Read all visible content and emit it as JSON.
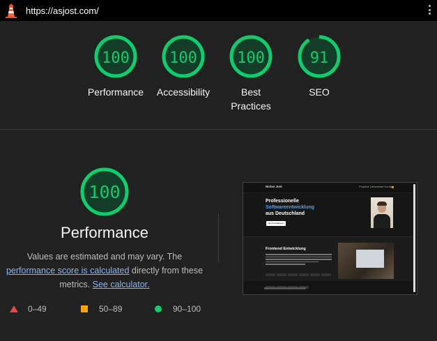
{
  "browser": {
    "url": "https://asjost.com/"
  },
  "scores": [
    {
      "key": "performance",
      "value": "100",
      "label_lines": [
        "Performance"
      ],
      "score": 100
    },
    {
      "key": "accessibility",
      "value": "100",
      "label_lines": [
        "Accessibility"
      ],
      "score": 100
    },
    {
      "key": "best_practices",
      "value": "100",
      "label_lines": [
        "Best",
        "Practices"
      ],
      "score": 100
    },
    {
      "key": "seo",
      "value": "91",
      "label_lines": [
        "SEO"
      ],
      "score": 91
    }
  ],
  "detail": {
    "score": "100",
    "title": "Performance",
    "desc_part1": "Values are estimated and may vary. The",
    "link1": "performance score is calculated",
    "desc_part2": "directly from these metrics.",
    "link2": "See calculator."
  },
  "legend": {
    "fail": "0–49",
    "average": "50–89",
    "pass": "90–100"
  },
  "thumbnail": {
    "brand": "Niclas Jost",
    "nav_links": "Projekte   Lebenslauf   Kontakt",
    "hero_line1": "Professionelle",
    "hero_line2": "Softwareentwicklung",
    "hero_line3": "aus Deutschland",
    "cta": "Jetzt kontaktieren",
    "section_title": "Frontend Entwicklung"
  },
  "colors": {
    "pass": "#0cce6b",
    "pass_text": "#08a655",
    "gauge_fill": "#143d29",
    "average": "#ffa400",
    "fail": "#ef4444",
    "link": "#8ab4f8"
  }
}
